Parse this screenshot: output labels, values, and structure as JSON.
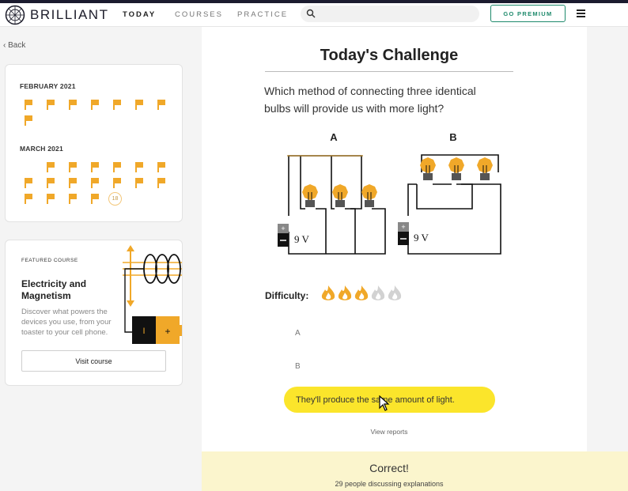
{
  "header": {
    "brand": "BRILLIANT",
    "nav": {
      "today": "TODAY",
      "courses": "COURSES",
      "practice": "PRACTICE"
    },
    "search_placeholder": "",
    "premium_label": "GO PREMIUM"
  },
  "sidebar": {
    "back_label": "Back",
    "calendar": {
      "month1": "FEBRUARY 2021",
      "month2": "MARCH 2021",
      "current_day": "18"
    },
    "featured": {
      "tag": "FEATURED COURSE",
      "title": "Electricity and Magnetism",
      "description": "Discover what powers the devices you use, from your toaster to your cell phone.",
      "button": "Visit course"
    }
  },
  "main": {
    "title": "Today's Challenge",
    "question": "Which method of connecting three identical bulbs will provide us with more light?",
    "diagram": {
      "label_a": "A",
      "label_b": "B",
      "voltage_a": "9 V",
      "voltage_b": "9 V"
    },
    "difficulty_label": "Difficulty:",
    "difficulty_level": 3,
    "difficulty_max": 5,
    "options": [
      "A",
      "B"
    ],
    "selected_answer": "They'll produce the same amount of light.",
    "view_reports": "View reports",
    "result": "Correct!",
    "discussion": "29 people discussing explanations"
  },
  "colors": {
    "accent_orange": "#f0a829",
    "answer_yellow": "#fbe52b",
    "premium_green": "#1e8a6c",
    "banner": "#fbf5cd"
  }
}
